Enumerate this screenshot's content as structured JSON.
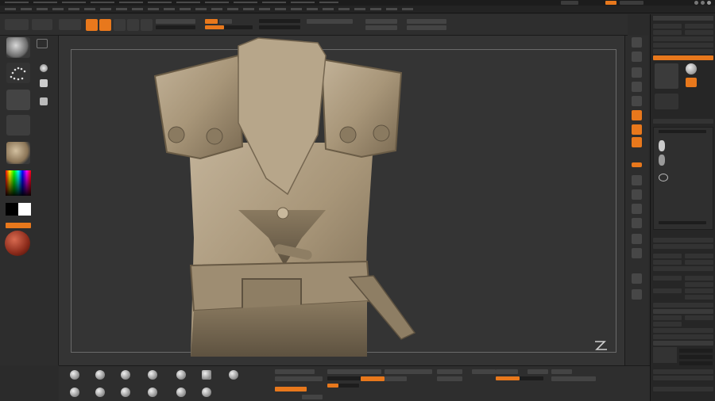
{
  "colors": {
    "accent": "#e8781c",
    "background": "#2b2b2b",
    "canvas": "#343434",
    "model": "#a8977c"
  },
  "icons": {
    "standard-brush": "sphere",
    "stroke": "dots-arc",
    "alpha": "blank",
    "texture": "blank",
    "material": "sphere",
    "color-picker": "hue-square",
    "zbrush-logo": "zbrush-logo",
    "lightbox": "sphere"
  },
  "canvas": {
    "model_description": ""
  },
  "tool_panel": {
    "title": ""
  }
}
